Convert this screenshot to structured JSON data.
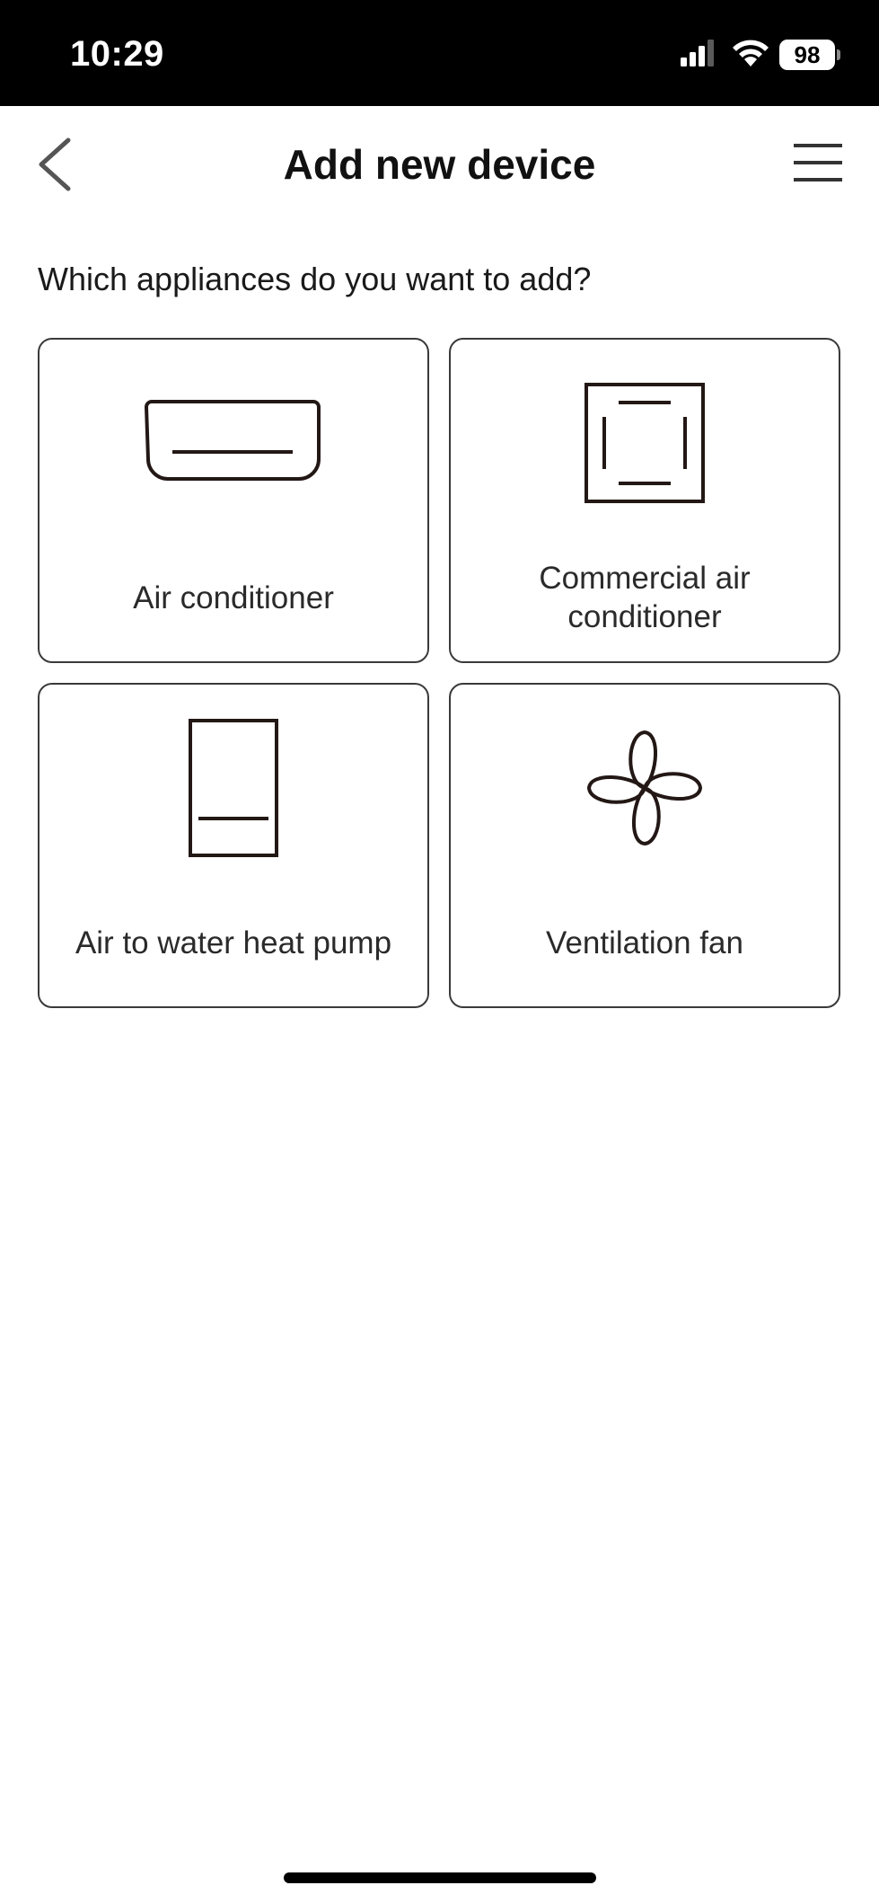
{
  "status_bar": {
    "time": "10:29",
    "battery": "98"
  },
  "header": {
    "title": "Add new device",
    "back_icon": "chevron-left-icon",
    "menu_icon": "hamburger-menu-icon"
  },
  "main": {
    "question": "Which appliances do you want to add?",
    "appliances": [
      {
        "label": "Air conditioner",
        "icon": "wall-air-conditioner-icon"
      },
      {
        "label": "Commercial air conditioner",
        "icon": "ceiling-cassette-icon"
      },
      {
        "label": "Air to water heat pump",
        "icon": "heat-pump-icon"
      },
      {
        "label": "Ventilation fan",
        "icon": "fan-icon"
      }
    ]
  },
  "colors": {
    "status_bar_bg": "#000000",
    "tile_border": "#3a3a3a",
    "icon_stroke": "#231815"
  }
}
